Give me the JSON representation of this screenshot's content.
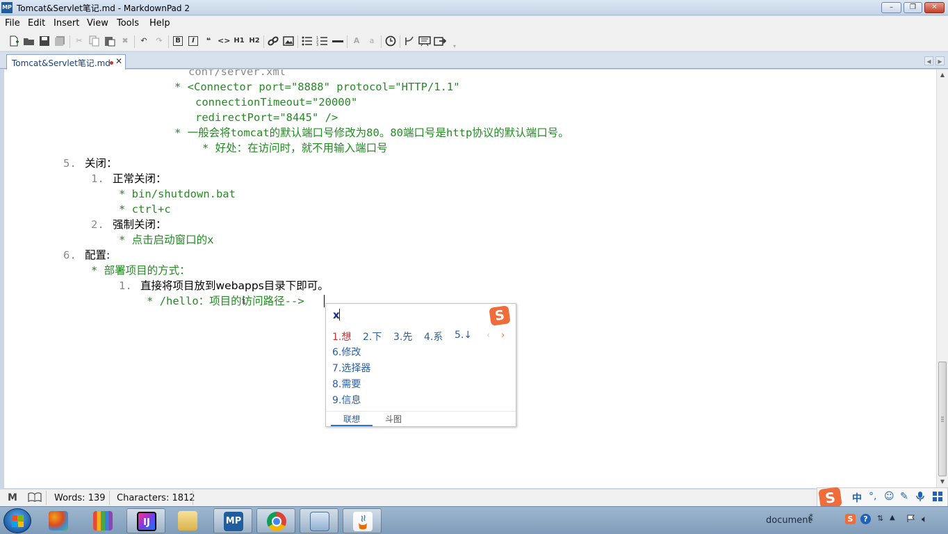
{
  "window": {
    "title": "Tomcat&Servlet笔记.md - MarkdownPad 2",
    "app_icon": "MP"
  },
  "window_controls": {
    "minimize": "–",
    "maximize": "❐",
    "close": "✕"
  },
  "menu": [
    "File",
    "Edit",
    "Insert",
    "View",
    "Tools",
    "Help"
  ],
  "toolbar": {
    "icons": [
      "new-file",
      "open-folder",
      "save",
      "save-all",
      "cut",
      "copy",
      "paste",
      "delete",
      "undo",
      "redo",
      "bold",
      "italic",
      "quote",
      "code",
      "h1",
      "h2",
      "link",
      "image",
      "bullet-list",
      "numbered-list",
      "horizontal-rule",
      "uppercase",
      "lowercase",
      "timestamp",
      "git",
      "preview",
      "export"
    ],
    "bold": "B",
    "italic": "I",
    "quote": "❝",
    "code": "<>",
    "h1": "H1",
    "h2": "H2",
    "upper": "A",
    "lower": "a"
  },
  "tab": {
    "label": "Tomcat&Servlet笔记.md",
    "close": "✕"
  },
  "editor": {
    "lines": [
      {
        "text": "conf/server.xml",
        "color": "gray"
      },
      {
        "text": "* <Connector port=\"8888\" protocol=\"HTTP/1.1\"",
        "color": "green"
      },
      {
        "text": "connectionTimeout=\"20000\"",
        "color": "green"
      },
      {
        "text": "redirectPort=\"8445\" />",
        "color": "green"
      },
      {
        "text": "* 一般会将tomcat的默认端口号修改为80。80端口号是http协议的默认端口号。",
        "color": "green"
      },
      {
        "text": "* 好处：在访问时，就不用输入端口号",
        "color": "green"
      },
      {
        "num": "5.",
        "text": "关闭："
      },
      {
        "num": "1.",
        "text": "正常关闭："
      },
      {
        "text": "* bin/shutdown.bat",
        "color": "green"
      },
      {
        "text": "* ctrl+c",
        "color": "green"
      },
      {
        "num": "2.",
        "text": "强制关闭："
      },
      {
        "text": "* 点击启动窗口的x",
        "color": "green"
      },
      {
        "num": "6.",
        "text": "配置:"
      },
      {
        "text": "* 部署项目的方式：",
        "color": "green"
      },
      {
        "num": "1.",
        "text": "直接将项目放到webapps目录下即可。"
      },
      {
        "text": "* /hello：项目的访问路径-->",
        "color": "green"
      }
    ]
  },
  "ime": {
    "pinyin": "x",
    "candidates": [
      "1.想",
      "2.下",
      "3.先",
      "4.系",
      "5.↓",
      "6.修改",
      "7.选择器",
      "8.需要",
      "9.信息"
    ],
    "prev": "‹",
    "next": "›",
    "tabs": [
      "联想",
      "斗图"
    ],
    "logo": "S"
  },
  "status": {
    "words": "Words: 139",
    "characters": "Characters: 1812",
    "markdown_icon": "M"
  },
  "ime_toolbar": {
    "logo": "S",
    "mode": "中",
    "punct": "°,"
  },
  "taskbar": {
    "apps": [
      "office",
      "pencils",
      "intellij-idea",
      "file-explorer",
      "markdownpad",
      "chrome",
      "remote-desktop",
      "java"
    ],
    "mp_label": "MP",
    "ij_label": "IJ",
    "tray_text": "document"
  }
}
